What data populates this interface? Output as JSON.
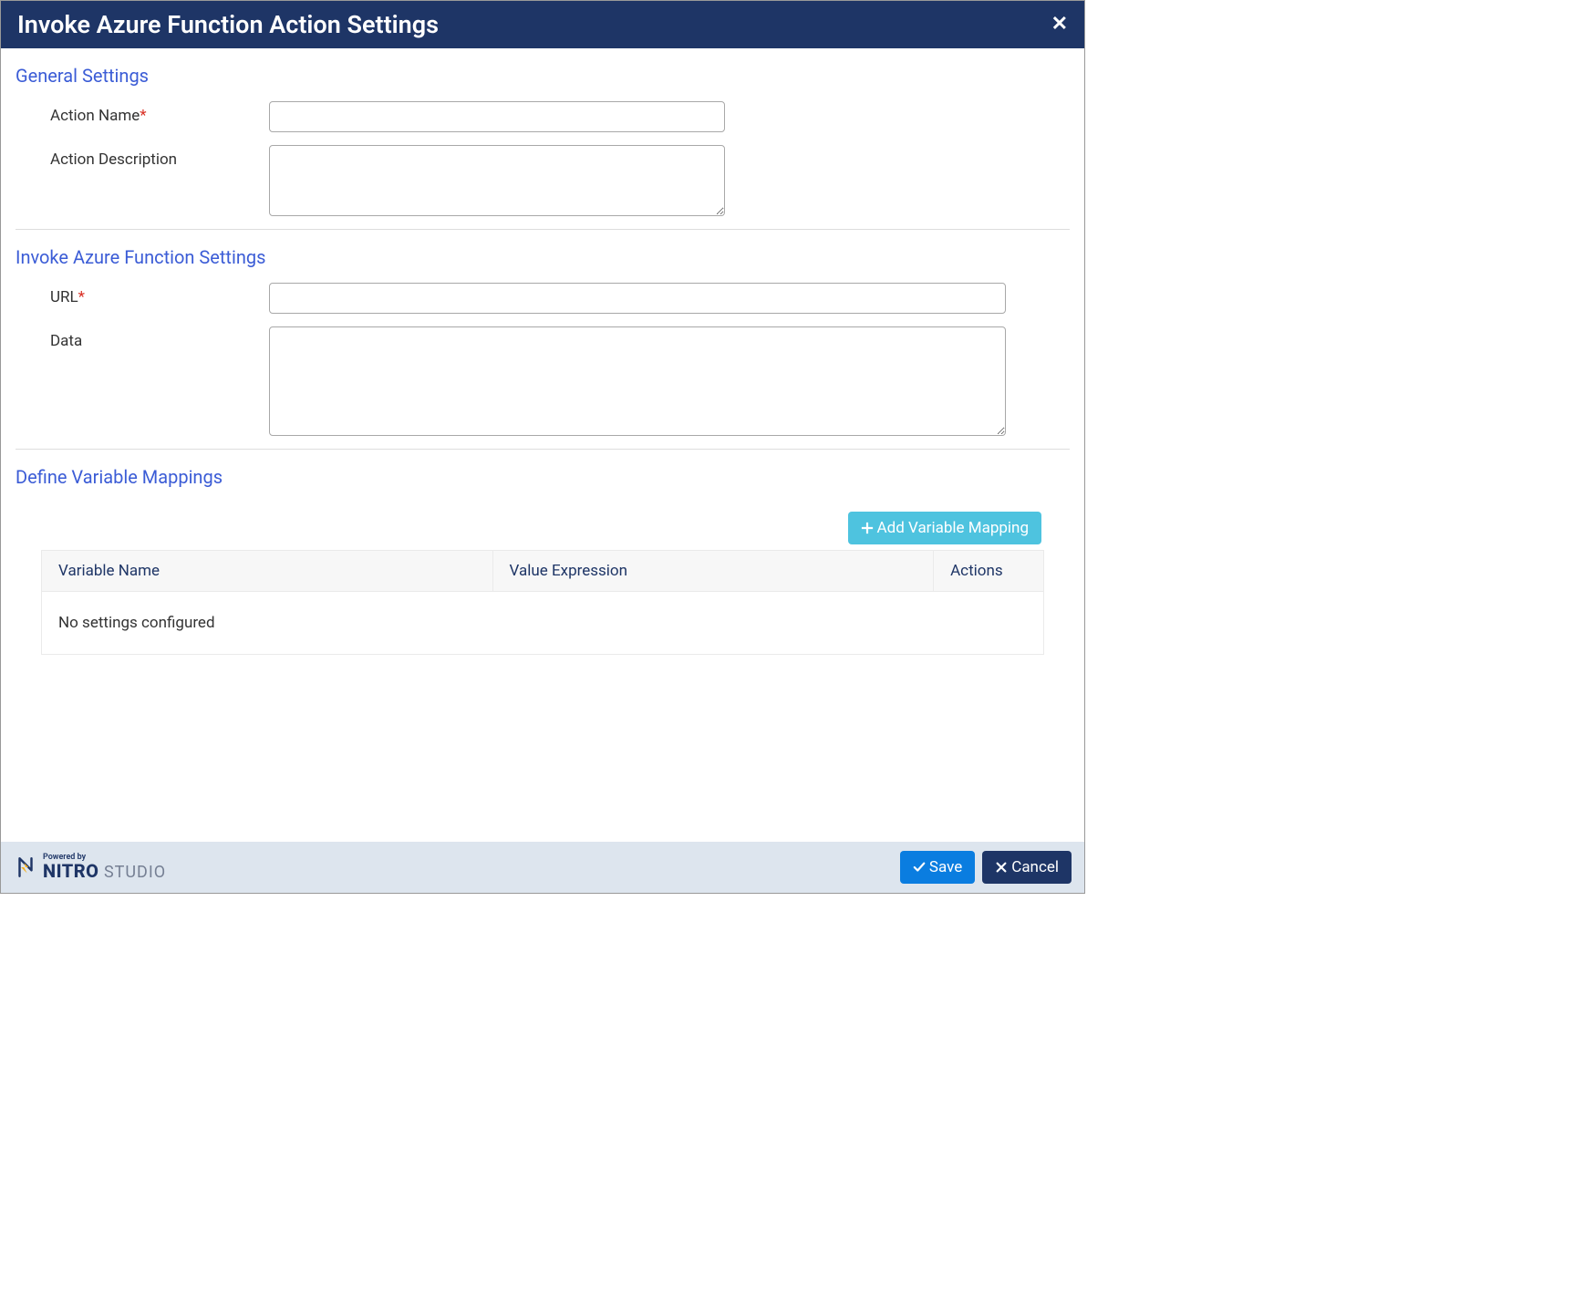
{
  "header": {
    "title": "Invoke Azure Function Action Settings"
  },
  "sections": {
    "general": {
      "title": "General Settings",
      "action_name_label": "Action Name",
      "action_name_value": "",
      "action_description_label": "Action Description",
      "action_description_value": ""
    },
    "invoke": {
      "title": "Invoke Azure Function Settings",
      "url_label": "URL",
      "url_value": "",
      "data_label": "Data",
      "data_value": ""
    },
    "mappings": {
      "title": "Define Variable Mappings",
      "add_button_label": "Add Variable Mapping",
      "columns": {
        "variable_name": "Variable Name",
        "value_expression": "Value Expression",
        "actions": "Actions"
      },
      "empty_message": "No settings configured"
    }
  },
  "footer": {
    "brand_powered": "Powered by",
    "brand_name": "NITRO",
    "brand_studio": " STUDIO",
    "save_label": "Save",
    "cancel_label": "Cancel"
  },
  "required_marker": "*"
}
